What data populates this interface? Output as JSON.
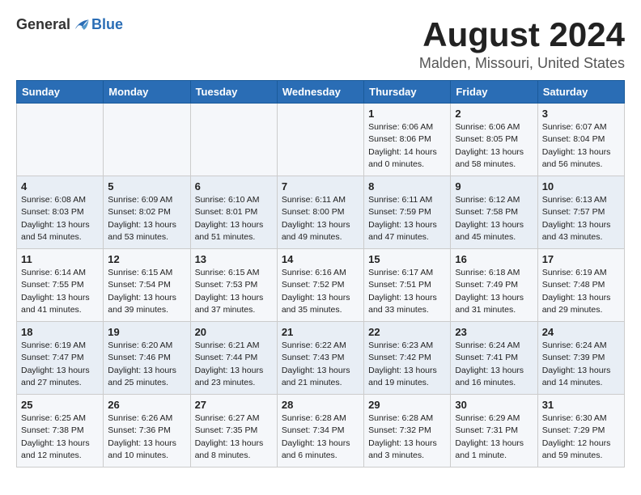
{
  "header": {
    "logo_general": "General",
    "logo_blue": "Blue",
    "month_title": "August 2024",
    "location": "Malden, Missouri, United States"
  },
  "weekdays": [
    "Sunday",
    "Monday",
    "Tuesday",
    "Wednesday",
    "Thursday",
    "Friday",
    "Saturday"
  ],
  "weeks": [
    [
      {
        "day": "",
        "content": ""
      },
      {
        "day": "",
        "content": ""
      },
      {
        "day": "",
        "content": ""
      },
      {
        "day": "",
        "content": ""
      },
      {
        "day": "1",
        "content": "Sunrise: 6:06 AM\nSunset: 8:06 PM\nDaylight: 14 hours\nand 0 minutes."
      },
      {
        "day": "2",
        "content": "Sunrise: 6:06 AM\nSunset: 8:05 PM\nDaylight: 13 hours\nand 58 minutes."
      },
      {
        "day": "3",
        "content": "Sunrise: 6:07 AM\nSunset: 8:04 PM\nDaylight: 13 hours\nand 56 minutes."
      }
    ],
    [
      {
        "day": "4",
        "content": "Sunrise: 6:08 AM\nSunset: 8:03 PM\nDaylight: 13 hours\nand 54 minutes."
      },
      {
        "day": "5",
        "content": "Sunrise: 6:09 AM\nSunset: 8:02 PM\nDaylight: 13 hours\nand 53 minutes."
      },
      {
        "day": "6",
        "content": "Sunrise: 6:10 AM\nSunset: 8:01 PM\nDaylight: 13 hours\nand 51 minutes."
      },
      {
        "day": "7",
        "content": "Sunrise: 6:11 AM\nSunset: 8:00 PM\nDaylight: 13 hours\nand 49 minutes."
      },
      {
        "day": "8",
        "content": "Sunrise: 6:11 AM\nSunset: 7:59 PM\nDaylight: 13 hours\nand 47 minutes."
      },
      {
        "day": "9",
        "content": "Sunrise: 6:12 AM\nSunset: 7:58 PM\nDaylight: 13 hours\nand 45 minutes."
      },
      {
        "day": "10",
        "content": "Sunrise: 6:13 AM\nSunset: 7:57 PM\nDaylight: 13 hours\nand 43 minutes."
      }
    ],
    [
      {
        "day": "11",
        "content": "Sunrise: 6:14 AM\nSunset: 7:55 PM\nDaylight: 13 hours\nand 41 minutes."
      },
      {
        "day": "12",
        "content": "Sunrise: 6:15 AM\nSunset: 7:54 PM\nDaylight: 13 hours\nand 39 minutes."
      },
      {
        "day": "13",
        "content": "Sunrise: 6:15 AM\nSunset: 7:53 PM\nDaylight: 13 hours\nand 37 minutes."
      },
      {
        "day": "14",
        "content": "Sunrise: 6:16 AM\nSunset: 7:52 PM\nDaylight: 13 hours\nand 35 minutes."
      },
      {
        "day": "15",
        "content": "Sunrise: 6:17 AM\nSunset: 7:51 PM\nDaylight: 13 hours\nand 33 minutes."
      },
      {
        "day": "16",
        "content": "Sunrise: 6:18 AM\nSunset: 7:49 PM\nDaylight: 13 hours\nand 31 minutes."
      },
      {
        "day": "17",
        "content": "Sunrise: 6:19 AM\nSunset: 7:48 PM\nDaylight: 13 hours\nand 29 minutes."
      }
    ],
    [
      {
        "day": "18",
        "content": "Sunrise: 6:19 AM\nSunset: 7:47 PM\nDaylight: 13 hours\nand 27 minutes."
      },
      {
        "day": "19",
        "content": "Sunrise: 6:20 AM\nSunset: 7:46 PM\nDaylight: 13 hours\nand 25 minutes."
      },
      {
        "day": "20",
        "content": "Sunrise: 6:21 AM\nSunset: 7:44 PM\nDaylight: 13 hours\nand 23 minutes."
      },
      {
        "day": "21",
        "content": "Sunrise: 6:22 AM\nSunset: 7:43 PM\nDaylight: 13 hours\nand 21 minutes."
      },
      {
        "day": "22",
        "content": "Sunrise: 6:23 AM\nSunset: 7:42 PM\nDaylight: 13 hours\nand 19 minutes."
      },
      {
        "day": "23",
        "content": "Sunrise: 6:24 AM\nSunset: 7:41 PM\nDaylight: 13 hours\nand 16 minutes."
      },
      {
        "day": "24",
        "content": "Sunrise: 6:24 AM\nSunset: 7:39 PM\nDaylight: 13 hours\nand 14 minutes."
      }
    ],
    [
      {
        "day": "25",
        "content": "Sunrise: 6:25 AM\nSunset: 7:38 PM\nDaylight: 13 hours\nand 12 minutes."
      },
      {
        "day": "26",
        "content": "Sunrise: 6:26 AM\nSunset: 7:36 PM\nDaylight: 13 hours\nand 10 minutes."
      },
      {
        "day": "27",
        "content": "Sunrise: 6:27 AM\nSunset: 7:35 PM\nDaylight: 13 hours\nand 8 minutes."
      },
      {
        "day": "28",
        "content": "Sunrise: 6:28 AM\nSunset: 7:34 PM\nDaylight: 13 hours\nand 6 minutes."
      },
      {
        "day": "29",
        "content": "Sunrise: 6:28 AM\nSunset: 7:32 PM\nDaylight: 13 hours\nand 3 minutes."
      },
      {
        "day": "30",
        "content": "Sunrise: 6:29 AM\nSunset: 7:31 PM\nDaylight: 13 hours\nand 1 minute."
      },
      {
        "day": "31",
        "content": "Sunrise: 6:30 AM\nSunset: 7:29 PM\nDaylight: 12 hours\nand 59 minutes."
      }
    ]
  ]
}
